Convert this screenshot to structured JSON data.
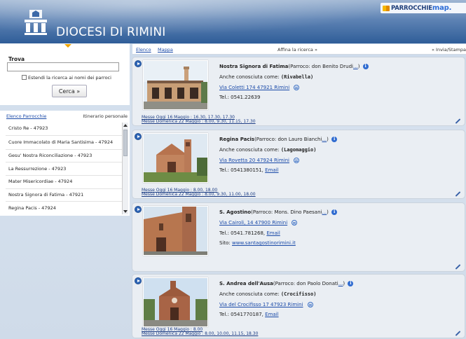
{
  "header": {
    "title": "DIOCESI DI RIMINI",
    "brand_part1": "PARROCCHIE",
    "brand_part2": "map.",
    "logo_icon": "diocese-crest-icon"
  },
  "search": {
    "label": "Trova",
    "input_value": "",
    "extend_label": "Estendi la ricerca ai nomi dei parroci",
    "extend_checked": false,
    "button_label": "Cerca »"
  },
  "list": {
    "tab_parishes": "Elenco Parrocchie",
    "tab_itinerary": "Itinerario personale",
    "items": [
      "Cristo Re - 47923",
      "Cuore Immacolato di Maria Santisima - 47924",
      "Gesu' Nostra Riconciliazione - 47923",
      "La Ressurrezione - 47923",
      "Mater Misericordiae - 47924",
      "Nostra Signora di Fatima - 47921",
      "Regina Pacis - 47924"
    ]
  },
  "toolbar": {
    "elenco": "Elenco",
    "mappa": "Mappa",
    "affina": "Affina la ricerca »",
    "invia": "« Invia/Stampa"
  },
  "cards": [
    {
      "name": "Nostra Signora di Fatima",
      "parroco": "(Parroco: don Benito Drudi",
      "parroco_more": "...",
      "parroco_close": ")",
      "alias_prefix": "Anche conosciuta come: ",
      "alias": "(Rivabella)",
      "address": "Via Coletti 174 47921 Rimini",
      "phone": "Tel.: 0541.22639",
      "email": "",
      "site_prefix": "",
      "site": "",
      "mass_today": "Messe Oggi 16 Maggio : 16.30, 17.30, 17.30",
      "mass_sunday": "Messe Domenica 22 Maggio : 8.00, 9.30, 11.15, 17.30"
    },
    {
      "name": "Regina Pacis",
      "parroco": "(Parroco: don Lauro Bianchi",
      "parroco_more": "...",
      "parroco_close": ")",
      "alias_prefix": "Anche conosciuta come: ",
      "alias": "(Lagomaggio)",
      "address": "Via Rovetta 20 47924 Rimini",
      "phone": "Tel.: 0541380151, ",
      "email": "Email",
      "site_prefix": "",
      "site": "",
      "mass_today": "Messe Oggi 16 Maggio : 8.00, 18.00",
      "mass_sunday": "Messe Domenica 22 Maggio : 8.00, 9.30, 11.00, 18.00"
    },
    {
      "name": "S. Agostino",
      "parroco": "(Parroco: Mons. Dino Paesani",
      "parroco_more": "...",
      "parroco_close": ")",
      "alias_prefix": "",
      "alias": "",
      "address": "Via Cairoli, 14 47900 Rimini",
      "phone": "Tel.: 0541.781268, ",
      "email": "Email",
      "site_prefix": "Sito: ",
      "site": "www.santagostinorimini.it",
      "mass_today": "",
      "mass_sunday": ""
    },
    {
      "name": "S. Andrea dell'Ausa",
      "parroco": "(Parroco: don Paolo Donati",
      "parroco_more": "...",
      "parroco_close": ")",
      "alias_prefix": "Anche conosciuta come: ",
      "alias": "(Crocifisso)",
      "address": "Via del Crocifisso 17 47923 Rimini",
      "phone": "Tel.: 0541770187, ",
      "email": "Email",
      "site_prefix": "",
      "site": "",
      "mass_today": "Messe Oggi 16 Maggio : 8.00",
      "mass_sunday": "Messe Domenica 22 Maggio : 8.00, 10.00, 11.15, 18.30"
    }
  ],
  "colors": {
    "header_dark": "#2f5d98",
    "link": "#1a4aa8",
    "card_bg": "#eaeef3",
    "accent_orange": "#f0a500"
  }
}
